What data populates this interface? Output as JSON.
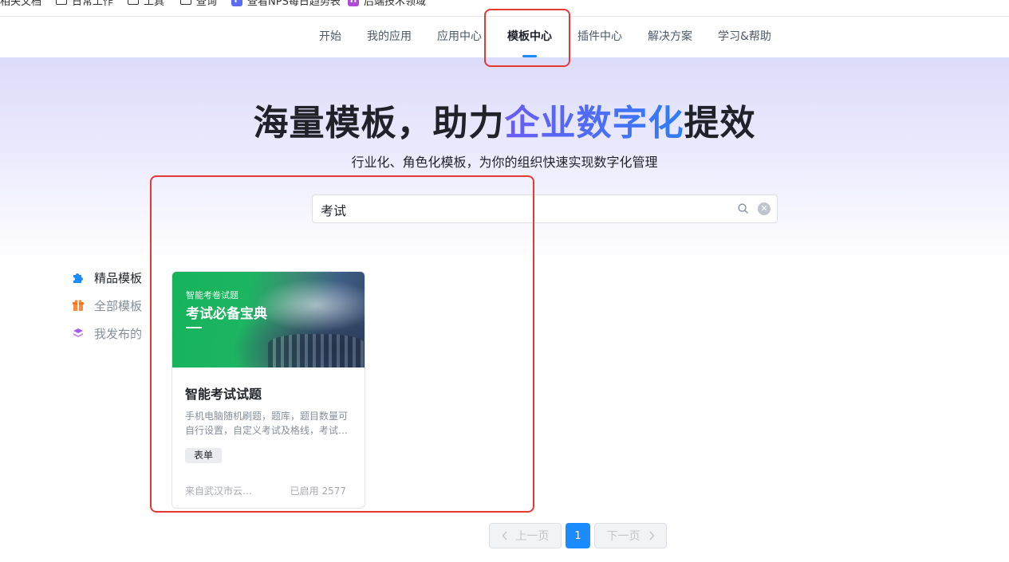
{
  "bookmarks": [
    {
      "label": "相关文档",
      "icon": "none"
    },
    {
      "label": "日常工作",
      "icon": "folder-icon"
    },
    {
      "label": "工具",
      "icon": "folder-icon"
    },
    {
      "label": "查询",
      "icon": "folder-icon"
    },
    {
      "label": "查看NPS每日趋势表",
      "icon": "badge-icon",
      "badge": "F",
      "color": "#5b6cf0"
    },
    {
      "label": "后端技术领域",
      "icon": "badge-icon",
      "badge": "H",
      "color": "#b14bd6"
    }
  ],
  "nav": {
    "tabs": [
      "开始",
      "我的应用",
      "应用中心",
      "模板中心",
      "插件中心",
      "解决方案",
      "学习&帮助"
    ],
    "active_tab": "模板中心",
    "active_color": "#1a8cff"
  },
  "hero": {
    "title_prefix": "海量模板，助力",
    "title_highlight": "企业数字化",
    "title_suffix": "提效",
    "subtitle": "行业化、角色化模板，为你的组织快速实现数字化管理"
  },
  "search": {
    "value": "考试",
    "icon": "search-icon",
    "clear_icon": "clear-icon"
  },
  "sidebar": {
    "items": [
      {
        "label": "精品模板",
        "icon": "puzzle-icon",
        "color": "#1a8cff",
        "active": true
      },
      {
        "label": "全部模板",
        "icon": "gift-icon",
        "color": "#ff8a3d",
        "active": false
      },
      {
        "label": "我发布的",
        "icon": "layers-icon",
        "color": "#a35cf0",
        "active": false
      }
    ]
  },
  "cards": [
    {
      "cover_subtitle": "智能考卷试题",
      "cover_title": "考试必备宝典",
      "title": "智能考试试题",
      "description": "手机电脑随机刷题，题库，题目数量可自行设置，自定义考试及格线，考试…",
      "tag": "表单",
      "source": "来自武汉市云…",
      "usage": "已启用 2577"
    }
  ],
  "pagination": {
    "prev_label": "上一页",
    "next_label": "下一页",
    "current_page": "1"
  },
  "annotation_color": "#e53935"
}
